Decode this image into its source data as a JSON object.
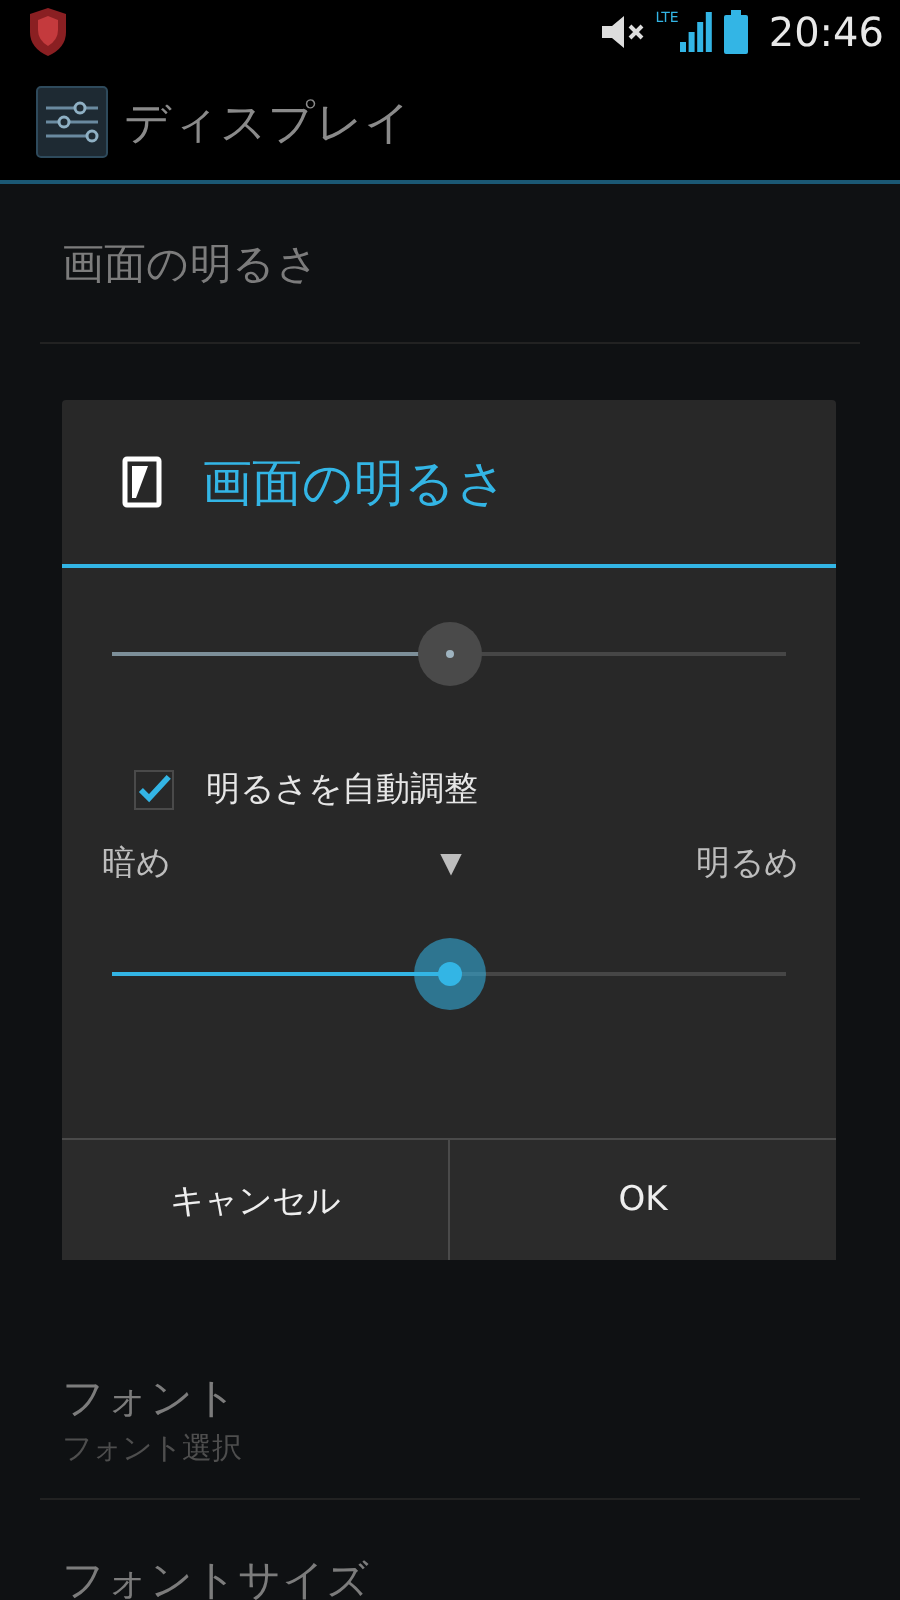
{
  "status_bar": {
    "time": "20:46",
    "network": "LTE"
  },
  "action_bar": {
    "title": "ディスプレイ"
  },
  "settings": [
    {
      "title": "画面の明るさ"
    },
    {
      "title": "フォント",
      "summary": "フォント選択"
    },
    {
      "title": "フォントサイズ"
    }
  ],
  "dialog": {
    "title": "画面の明るさ",
    "sliders": [
      {
        "kind": "manual",
        "level": 0.5,
        "disabled": true
      },
      {
        "kind": "adjust",
        "level": 0.5,
        "disabled": false,
        "low_label": "暗め",
        "marker": "▼",
        "high_label": "明るめ"
      }
    ],
    "auto_brightness": {
      "label": "明るさを自動調整",
      "checked": true
    },
    "buttons": [
      "キャンセル",
      "OK"
    ]
  }
}
